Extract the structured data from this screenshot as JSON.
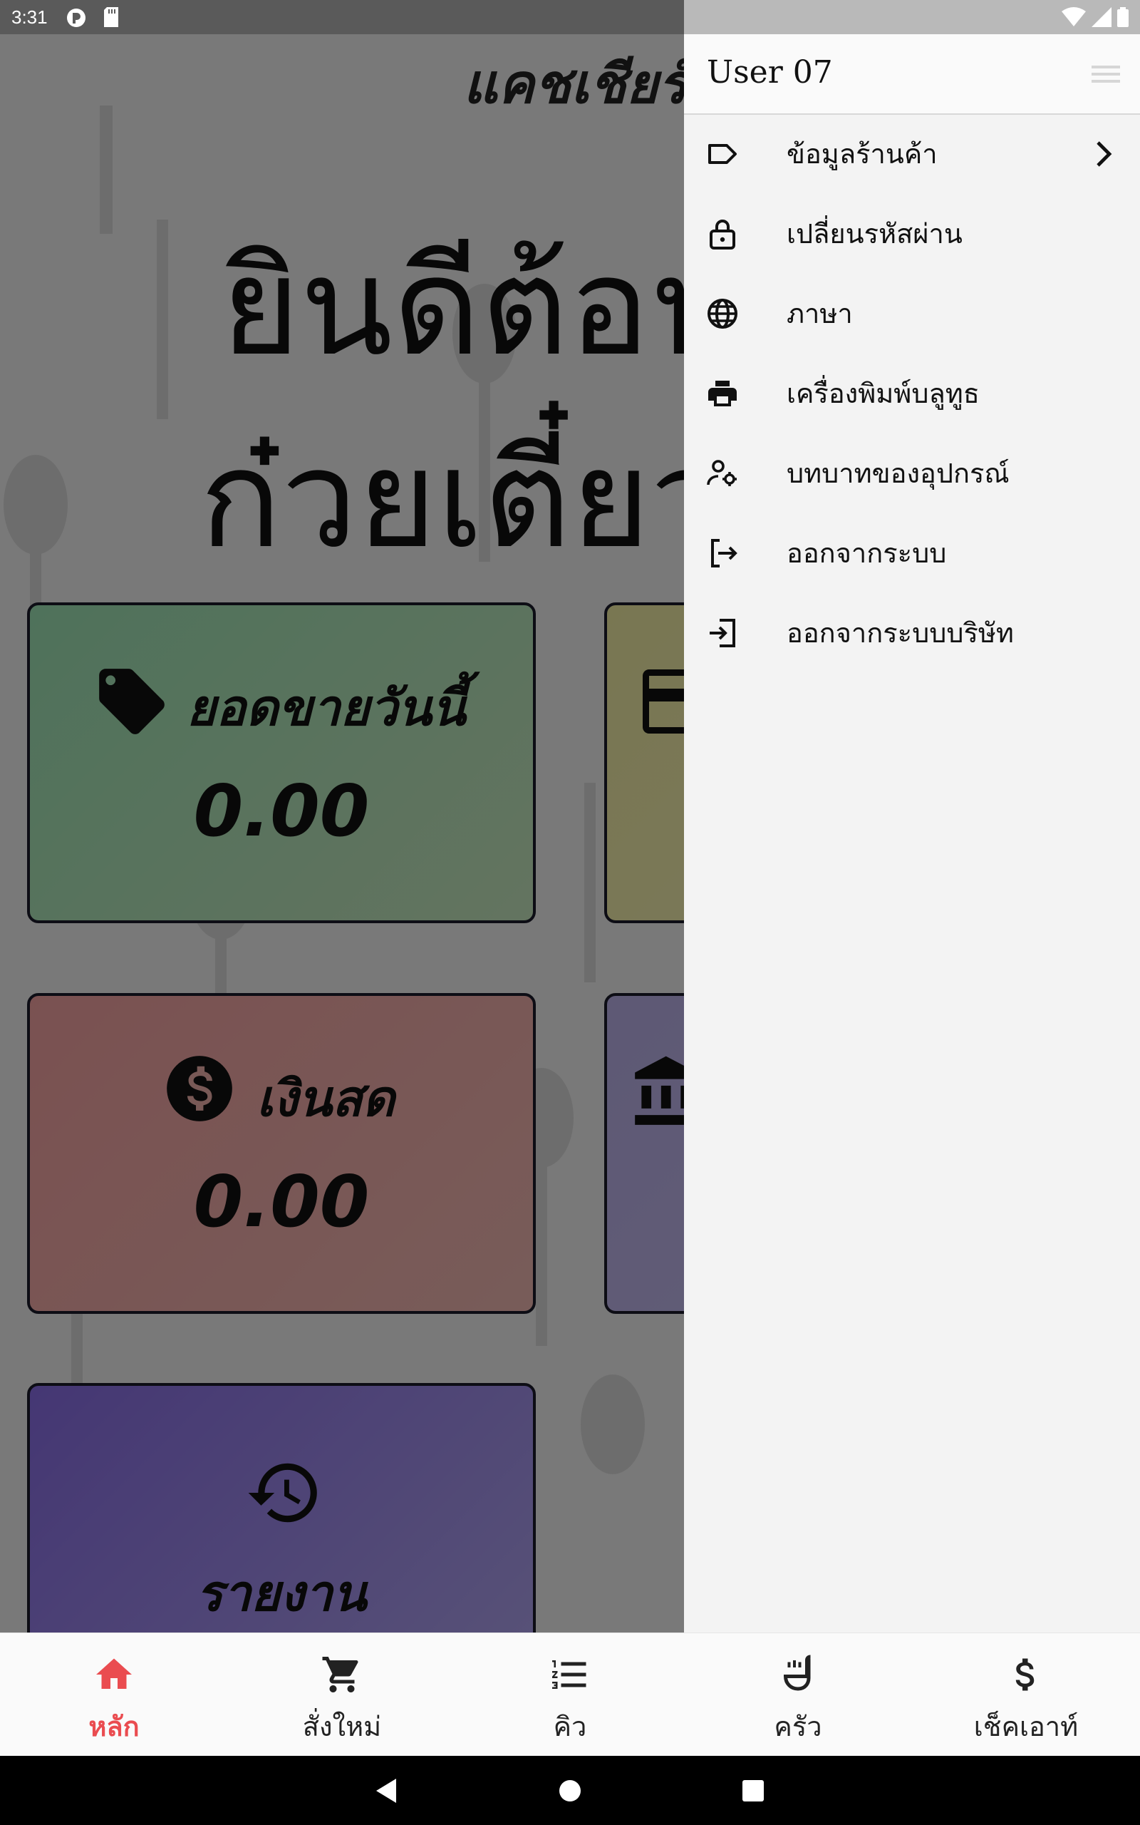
{
  "status_bar": {
    "time": "3:31"
  },
  "main": {
    "app_title": "แคชเชียร์",
    "welcome_line1": "ยินดีต้อนรับ",
    "welcome_line2": "ก๋วยเตี๋ยว",
    "cards": {
      "sales_today": {
        "label": "ยอดขายวันนี้",
        "value": "0.00",
        "icon": "tag-icon"
      },
      "card_payment": {
        "icon": "credit-card-icon"
      },
      "cash": {
        "label": "เงินสด",
        "value": "0.00",
        "icon": "dollar-circle-icon"
      },
      "transfer": {
        "icon": "bank-icon"
      },
      "report": {
        "label": "รายงาน",
        "icon": "history-icon"
      }
    }
  },
  "drawer": {
    "user_name": "User 07",
    "items": [
      {
        "label": "ข้อมูลร้านค้า",
        "icon": "store-tag-icon",
        "has_chevron": true
      },
      {
        "label": "เปลี่ยนรหัสผ่าน",
        "icon": "lock-icon"
      },
      {
        "label": "ภาษา",
        "icon": "globe-icon"
      },
      {
        "label": "เครื่องพิมพ์บลูทูธ",
        "icon": "printer-icon"
      },
      {
        "label": "บทบาทของอุปกรณ์",
        "icon": "user-gear-icon"
      },
      {
        "label": "ออกจากระบบ",
        "icon": "logout-icon"
      },
      {
        "label": "ออกจากระบบบริษัท",
        "icon": "login-box-icon"
      }
    ]
  },
  "bottom_nav": {
    "items": [
      {
        "label": "หลัก",
        "icon": "home-icon",
        "active": true
      },
      {
        "label": "สั่งใหม่",
        "icon": "cart-icon"
      },
      {
        "label": "คิว",
        "icon": "list-numbered-icon"
      },
      {
        "label": "ครัว",
        "icon": "ladle-icon"
      },
      {
        "label": "เช็คเอาท์",
        "icon": "dollar-icon"
      }
    ]
  },
  "colors": {
    "accent": "#ea4c50",
    "card_sales": "#9ee5b6",
    "card_card": "#f2eea5",
    "card_cash": "#f5a3a3",
    "card_transfer": "#bcb2ea",
    "card_report": "#8a6ee8"
  }
}
